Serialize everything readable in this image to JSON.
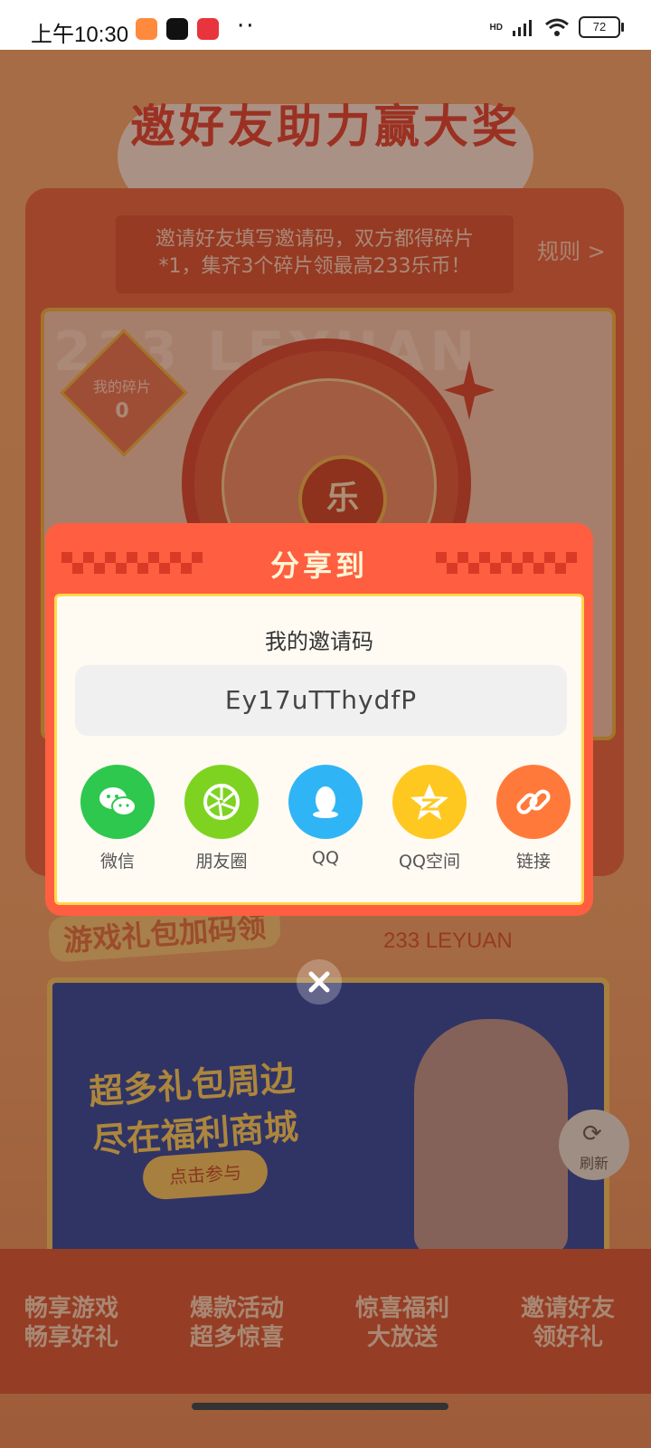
{
  "status_bar": {
    "time": "上午10:30",
    "network": "HD",
    "battery": "72"
  },
  "page": {
    "title": "邀好友助力赢大奖",
    "notice_line1": "邀请好友填写邀请码，双方都得碎片",
    "notice_line2": "*1，集齐3个碎片领最高233乐币！",
    "rules_link": "规则 >",
    "watermark": "233 LEYUAN",
    "wheel_center": "乐",
    "fragments_label": "我的碎片",
    "fragments_value": "0",
    "section_title": "游戏礼包加码领",
    "leyuan_label": "233 LEYUAN",
    "banner_line1": "超多礼包周边",
    "banner_line2": "尽在福利商城",
    "banner_button": "点击参与",
    "refresh_label": "刷新",
    "bottom_items": [
      {
        "line1": "畅享游戏",
        "line2": "畅享好礼"
      },
      {
        "line1": "爆款活动",
        "line2": "超多惊喜"
      },
      {
        "line1": "惊喜福利",
        "line2": "大放送"
      },
      {
        "line1": "邀请好友",
        "line2": "领好礼"
      }
    ]
  },
  "dialog": {
    "title": "分享到",
    "code_label": "我的邀请码",
    "code_value": "Ey17uTThydfP",
    "share_options": [
      {
        "label": "微信",
        "icon": "wechat-icon",
        "color": "#2dc84d"
      },
      {
        "label": "朋友圈",
        "icon": "moments-icon",
        "color": "#7ed321"
      },
      {
        "label": "QQ",
        "icon": "qq-icon",
        "color": "#2fb5f5"
      },
      {
        "label": "QQ空间",
        "icon": "qzone-icon",
        "color": "#ffc820"
      },
      {
        "label": "链接",
        "icon": "link-icon",
        "color": "#ff7a3a"
      }
    ]
  },
  "colors": {
    "dialog_bg": "#ff5e40",
    "accent_yellow": "#ffd84a"
  }
}
